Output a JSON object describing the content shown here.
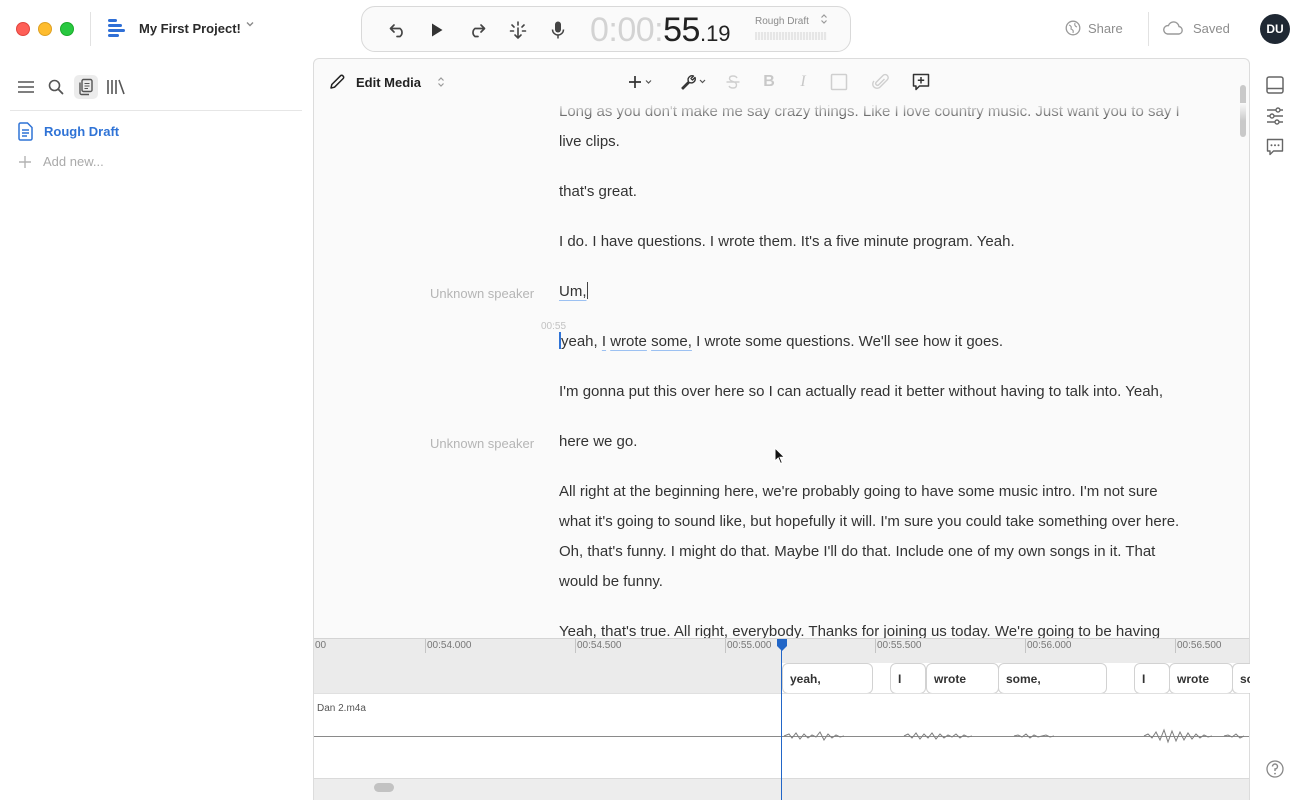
{
  "window": {
    "project_title": "My First Project!",
    "share_label": "Share",
    "saved_label": "Saved",
    "avatar_initials": "DU"
  },
  "transport": {
    "timecode_dim": "0:00:",
    "timecode_main": "55",
    "timecode_frac": ".19",
    "composition_label": "Rough Draft"
  },
  "sidebar": {
    "items": [
      {
        "label": "Rough Draft",
        "icon": "document-icon",
        "active": true
      }
    ],
    "add_label": "Add new..."
  },
  "editor": {
    "mode_label": "Edit Media",
    "toolbar_icons": [
      "add-icon",
      "wrench-icon",
      "strikethrough-icon",
      "bold-icon",
      "italic-icon",
      "box-icon",
      "attachment-icon",
      "add-comment-icon"
    ],
    "paragraphs": [
      {
        "text": "Long as you don't make me say crazy things. Like I love country music. Just want you to say I live clips."
      },
      {
        "text": "that's great."
      },
      {
        "text": "I do. I have questions. I wrote them. It's a five minute program. Yeah."
      },
      {
        "speaker": "Unknown speaker",
        "text": "Um,"
      },
      {
        "timestamp": "00:55",
        "words": [
          "yeah,",
          "I",
          "wrote",
          "some,",
          "I wrote some questions. We'll see how it goes."
        ]
      },
      {
        "text": "I'm gonna put this over here so I can actually read it better without having to talk into. Yeah,"
      },
      {
        "speaker": "Unknown speaker",
        "text": "here we go."
      },
      {
        "text": "All right at the beginning here, we're probably going to have some music intro. I'm not sure what it's going to sound like, but hopefully it will. I'm sure you could take something over here. Oh, that's funny. I might do that. Maybe I'll do that. Include one of my own songs in it. That would be funny."
      },
      {
        "text": "Yeah, that's true. All right, everybody. Thanks for joining us today. We're going to be having"
      }
    ]
  },
  "timeline": {
    "ruler_labels": [
      "00",
      "00:54.000",
      "00:54.500",
      "00:55.000",
      "00:55.500",
      "00:56.000",
      "00:56.500"
    ],
    "words": [
      "yeah,",
      "I",
      "wrote",
      "some,",
      "I",
      "wrote",
      "so"
    ],
    "track_name": "Dan 2.m4a"
  },
  "rail": {
    "icons": [
      "panel-icon",
      "sliders-icon",
      "comment-icon",
      "help-icon"
    ]
  },
  "colors": {
    "accent": "#2f73d6",
    "playhead": "#2266c7"
  }
}
